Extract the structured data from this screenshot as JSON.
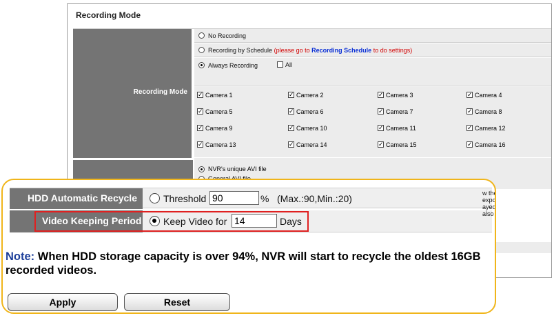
{
  "panel": {
    "title": "Recording Mode",
    "row_label": "Recording Mode",
    "no_recording": "No Recording",
    "by_schedule": "Recording by Schedule",
    "schedule_note_pre": "(please go to",
    "schedule_link": "Recording Schedule",
    "schedule_note_post": "to do settings)",
    "always_recording": "Always Recording",
    "all_label": "All",
    "cameras": [
      "Camera 1",
      "Camera 2",
      "Camera 3",
      "Camera 4",
      "Camera 5",
      "Camera 6",
      "Camera 7",
      "Camera 8",
      "Camera 9",
      "Camera 10",
      "Camera 11",
      "Camera 12",
      "Camera 13",
      "Camera 14",
      "Camera 15",
      "Camera 16"
    ],
    "avi_unique": "NVR's unique AVI file",
    "avi_general": "General AVI file",
    "side_note_1": "w the exported",
    "side_note_2": "ayed via also"
  },
  "callout": {
    "hdd_label": "HDD Automatic Recycle",
    "threshold_label": "Threshold",
    "threshold_value": "90",
    "threshold_unit": "%",
    "threshold_range": "(Max.:90,Min.:20)",
    "video_label": "Video Keeping Period",
    "keep_label": "Keep Video for",
    "keep_value": "14",
    "keep_unit": "Days",
    "note_prefix": "Note:",
    "note_text": " When HDD storage capacity is over 94%, NVR will start to recycle the oldest 16GB recorded videos.",
    "apply": "Apply",
    "reset": "Reset"
  },
  "state": {
    "recording_mode_selected": "always_recording",
    "all_checked": false,
    "cameras_checked": true,
    "avi_selected": "unique",
    "hdd_selected": "threshold",
    "video_keep_selected": true
  },
  "colors": {
    "label_bg": "#747474",
    "row_bg": "#ececec",
    "highlight_border": "#f0b51a",
    "focus_border": "#e02020",
    "note_prefix": "#1d3f9a",
    "link": "#0a2fd6",
    "warning": "#d20000"
  }
}
